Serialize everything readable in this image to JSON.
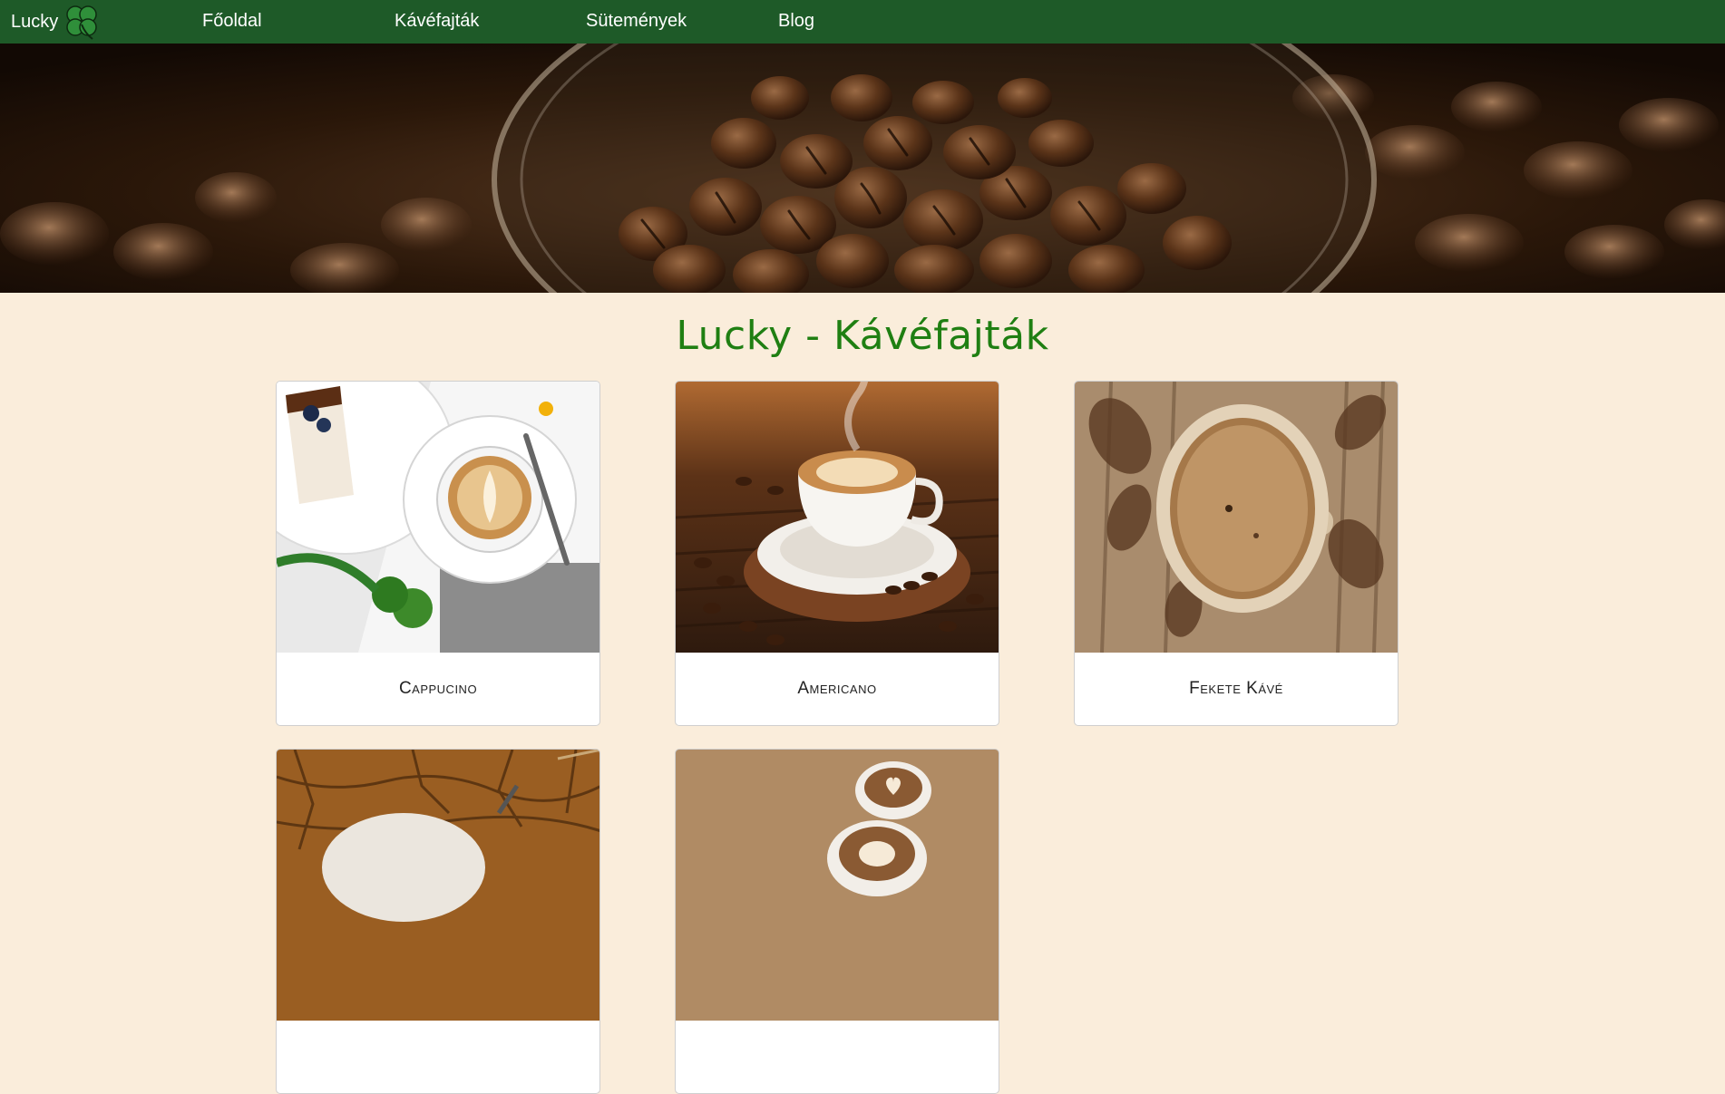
{
  "navbar": {
    "brand": "Lucky",
    "links": [
      "Főoldal",
      "Kávéfajták",
      "Sütemények",
      "Blog"
    ],
    "color": "#1e5a28"
  },
  "hero": {
    "icon": "coffee-beans-image"
  },
  "page_title": "Lucky - Kávéfajták",
  "title_color": "#1f7f12",
  "background": "#faeddb",
  "cards": [
    {
      "name": "Cappucino",
      "icon": "cappuccino-photo"
    },
    {
      "name": "Americano",
      "icon": "americano-photo"
    },
    {
      "name": "Fekete Kávé",
      "icon": "black-coffee-photo"
    },
    {
      "name": "",
      "icon": "coffee-on-wood-photo"
    },
    {
      "name": "",
      "icon": "latte-art-photo"
    }
  ]
}
